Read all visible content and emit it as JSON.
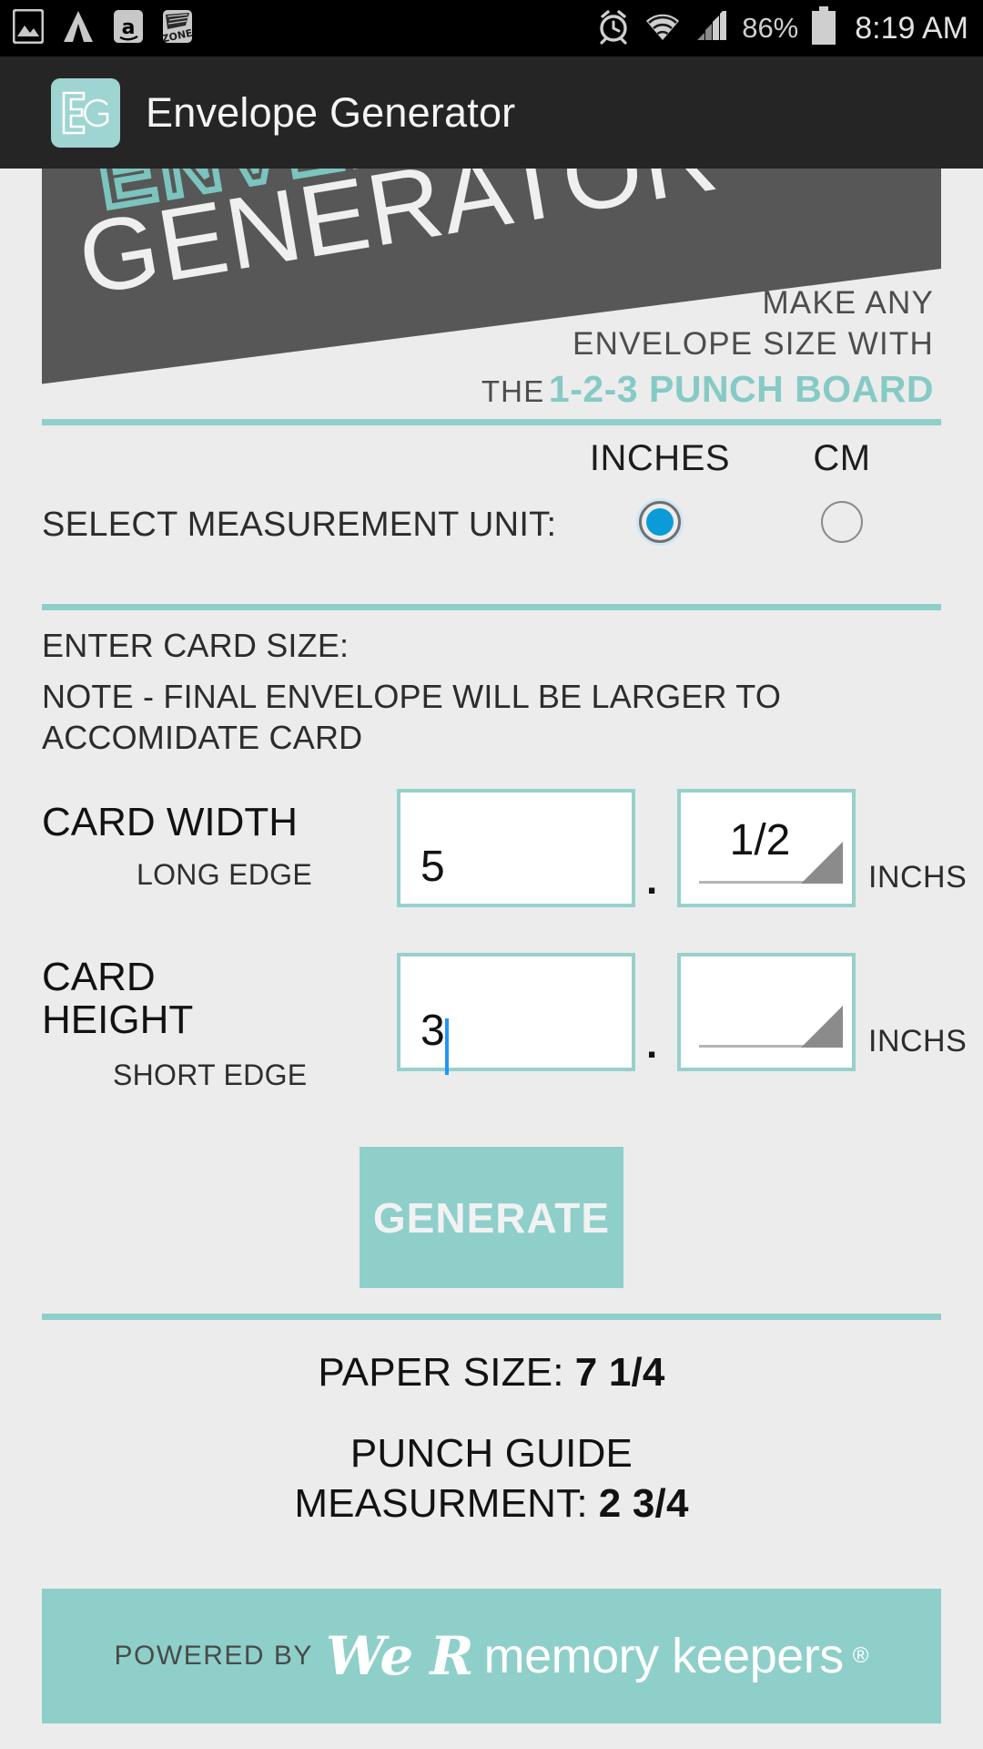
{
  "statusbar": {
    "icons": [
      "photo-icon",
      "triangle-app-icon",
      "amazon-icon",
      "zone-app-icon"
    ],
    "alarm_icon": "alarm-icon",
    "wifi_icon": "wifi-icon",
    "signal_icon": "signal-icon",
    "battery_percent": "86%",
    "battery_icon": "battery-icon",
    "time": "8:19 AM"
  },
  "appbar": {
    "icon_text": "EG",
    "title": "Envelope Generator"
  },
  "banner": {
    "envelope_word": "ENVELOPE",
    "generator_word": "GENERATOR",
    "tag_line1": "MAKE ANY",
    "tag_line2": "ENVELOPE SIZE WITH",
    "tag_the": "THE",
    "tag_punch": "1-2-3 PUNCH BOARD"
  },
  "unit": {
    "label": "SELECT MEASUREMENT UNIT:",
    "options": [
      {
        "name": "INCHES",
        "selected": true
      },
      {
        "name": "CM",
        "selected": false
      }
    ]
  },
  "card": {
    "enter_label": "ENTER CARD SIZE:",
    "note": "NOTE - FINAL ENVELOPE WILL BE LARGER TO ACCOMIDATE CARD",
    "width": {
      "label": "CARD WIDTH",
      "sub_label": "LONG EDGE",
      "whole_value": "5",
      "fraction_value": "1/2",
      "separator": ".",
      "unit_suffix": "INCHS"
    },
    "height": {
      "label_line1": "CARD",
      "label_line2": "HEIGHT",
      "sub_label": "SHORT EDGE",
      "whole_value": "3",
      "fraction_value": "",
      "separator": ".",
      "unit_suffix": "INCHS"
    }
  },
  "generate_button": "GENERATE",
  "results": {
    "paper_size_label": "PAPER SIZE:",
    "paper_size_value": "7 1/4",
    "punch_guide_line1": "PUNCH GUIDE",
    "punch_guide_label": "MEASURMENT:",
    "punch_guide_value": "2 3/4"
  },
  "footer": {
    "powered_by": "POWERED BY",
    "brand_script": "We R",
    "brand_name": "memory keepers",
    "registered": "®"
  },
  "colors": {
    "teal": "#8ecfca",
    "teal_light": "#97d0cc",
    "banner_dark": "#575757",
    "page_bg": "#ececec",
    "appbar_bg": "#252525",
    "radio_blue": "#0a9bd8"
  }
}
